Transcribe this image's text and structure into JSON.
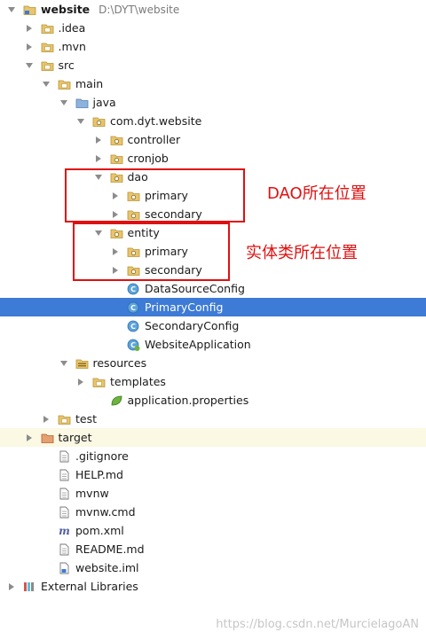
{
  "tree": [
    {
      "label": "website",
      "sub": "D:\\DYT\\website",
      "depth": 0,
      "expanded": true,
      "icon": "module-folder-icon",
      "bold": true
    },
    {
      "label": ".idea",
      "depth": 1,
      "expanded": false,
      "icon": "folder-icon"
    },
    {
      "label": ".mvn",
      "depth": 1,
      "expanded": false,
      "icon": "folder-icon"
    },
    {
      "label": "src",
      "depth": 1,
      "expanded": true,
      "icon": "folder-icon"
    },
    {
      "label": "main",
      "depth": 2,
      "expanded": true,
      "icon": "folder-icon"
    },
    {
      "label": "java",
      "depth": 3,
      "expanded": true,
      "icon": "source-folder-icon"
    },
    {
      "label": "com.dyt.website",
      "depth": 4,
      "expanded": true,
      "icon": "package-icon"
    },
    {
      "label": "controller",
      "depth": 5,
      "expanded": false,
      "icon": "package-icon"
    },
    {
      "label": "cronjob",
      "depth": 5,
      "expanded": false,
      "icon": "package-icon"
    },
    {
      "label": "dao",
      "depth": 5,
      "expanded": true,
      "icon": "package-icon"
    },
    {
      "label": "primary",
      "depth": 6,
      "expanded": false,
      "icon": "package-icon"
    },
    {
      "label": "secondary",
      "depth": 6,
      "expanded": false,
      "icon": "package-icon"
    },
    {
      "label": "entity",
      "depth": 5,
      "expanded": true,
      "icon": "package-icon"
    },
    {
      "label": "primary",
      "depth": 6,
      "expanded": false,
      "icon": "package-icon"
    },
    {
      "label": "secondary",
      "depth": 6,
      "expanded": false,
      "icon": "package-icon"
    },
    {
      "label": "DataSourceConfig",
      "depth": 6,
      "leaf": true,
      "icon": "java-class-icon"
    },
    {
      "label": "PrimaryConfig",
      "depth": 6,
      "leaf": true,
      "icon": "java-class-icon",
      "selected": true
    },
    {
      "label": "SecondaryConfig",
      "depth": 6,
      "leaf": true,
      "icon": "java-class-icon"
    },
    {
      "label": "WebsiteApplication",
      "depth": 6,
      "leaf": true,
      "icon": "spring-boot-class-icon"
    },
    {
      "label": "resources",
      "depth": 3,
      "expanded": true,
      "icon": "resources-folder-icon"
    },
    {
      "label": "templates",
      "depth": 4,
      "expanded": false,
      "icon": "folder-icon"
    },
    {
      "label": "application.properties",
      "depth": 5,
      "leaf": true,
      "icon": "spring-properties-icon"
    },
    {
      "label": "test",
      "depth": 2,
      "expanded": false,
      "icon": "folder-icon"
    },
    {
      "label": "target",
      "depth": 1,
      "expanded": false,
      "icon": "excluded-folder-icon",
      "excluded": true
    },
    {
      "label": ".gitignore",
      "depth": 2,
      "leaf": true,
      "icon": "text-file-icon"
    },
    {
      "label": "HELP.md",
      "depth": 2,
      "leaf": true,
      "icon": "text-file-icon"
    },
    {
      "label": "mvnw",
      "depth": 2,
      "leaf": true,
      "icon": "text-file-icon"
    },
    {
      "label": "mvnw.cmd",
      "depth": 2,
      "leaf": true,
      "icon": "text-file-icon"
    },
    {
      "label": "pom.xml",
      "depth": 2,
      "leaf": true,
      "icon": "maven-icon"
    },
    {
      "label": "README.md",
      "depth": 2,
      "leaf": true,
      "icon": "text-file-icon"
    },
    {
      "label": "website.iml",
      "depth": 2,
      "leaf": true,
      "icon": "iml-file-icon"
    },
    {
      "label": "External Libraries",
      "depth": 0,
      "expanded": false,
      "icon": "libraries-icon"
    }
  ],
  "annotations": {
    "dao_label": "DAO所在位置",
    "entity_label": "实体类所在位置"
  },
  "watermark": "https://blog.csdn.net/MurcielagoAN",
  "colors": {
    "selection": "#3d7bd6",
    "annotation": "#e01010",
    "excluded_row": "#fbf8e3"
  }
}
